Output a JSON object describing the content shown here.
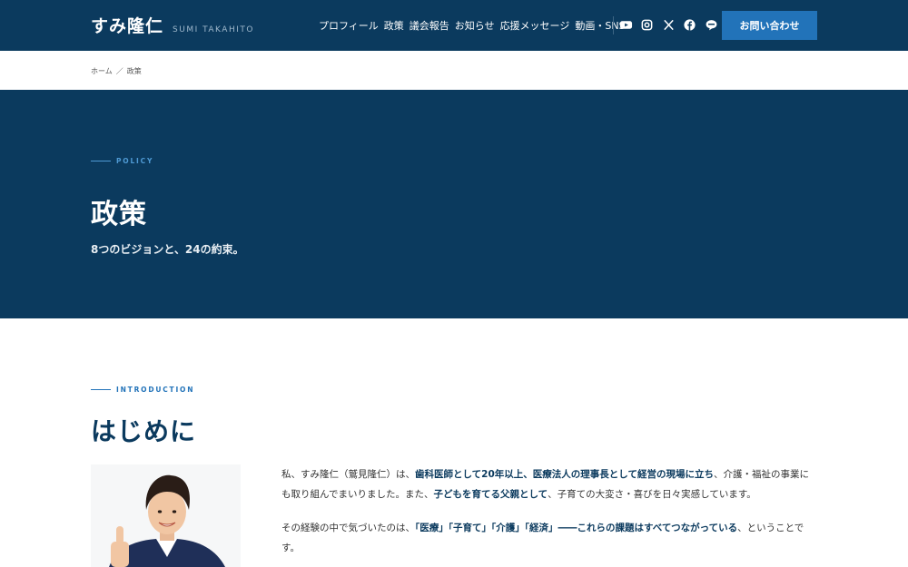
{
  "header": {
    "brand_name": "すみ隆仁",
    "brand_en": "SUMI TAKAHITO",
    "nav": [
      "プロフィール",
      "政策",
      "議会報告",
      "お知らせ",
      "応援メッセージ",
      "動画・SNS"
    ],
    "social_icons": [
      "youtube-icon",
      "instagram-icon",
      "x-icon",
      "facebook-icon",
      "line-icon"
    ],
    "contact_label": "お問い合わせ"
  },
  "breadcrumb": {
    "home": "ホーム",
    "separator": "／",
    "current": "政策"
  },
  "hero": {
    "eyebrow": "POLICY",
    "title": "政策",
    "subtitle": "8つのビジョンと、24の約束。"
  },
  "intro": {
    "eyebrow": "INTRODUCTION",
    "title": "はじめに",
    "p1": {
      "a": "私、すみ隆仁（鷲見隆仁）は、",
      "b": "歯科医師として20年以上、医療法人の理事長として経営の現場に立ち",
      "c": "、介護・福祉の事業にも取り組んでまいりました。また、",
      "d": "子どもを育てる父親として",
      "e": "、子育ての大変さ・喜びを日々実感しています。"
    },
    "p2": {
      "a": "その経験の中で気づいたのは、",
      "b": "「医療」「子育て」「介護」「経済」――これらの課題はすべてつながっている",
      "c": "、ということです。"
    }
  },
  "colors": {
    "navy": "#0b3a5e",
    "accent": "#2273b9",
    "eyebrow": "#4f9ad4"
  }
}
